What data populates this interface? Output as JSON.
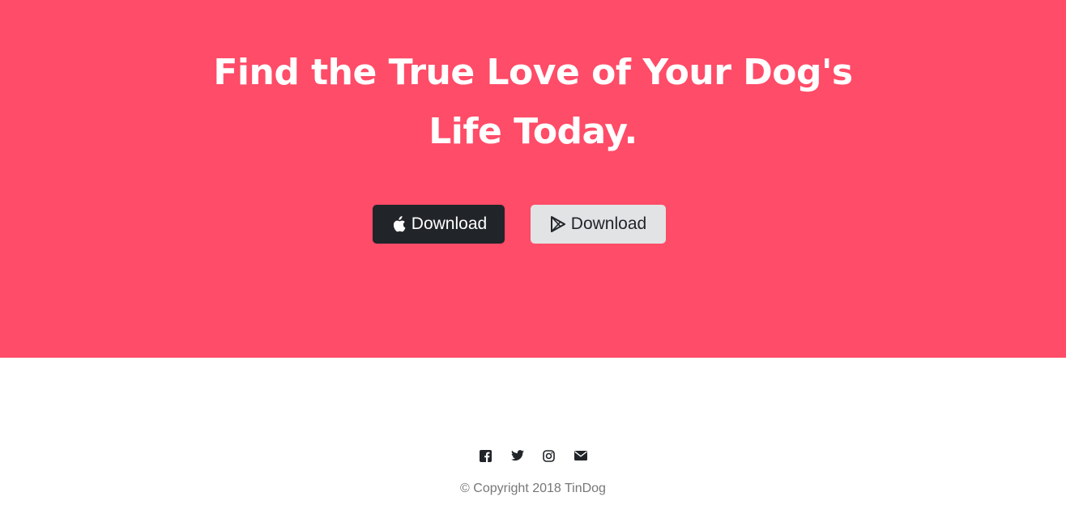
{
  "cta": {
    "background": "#ff4c68",
    "headline_line1": "Find the True Love of Your Dog's",
    "headline_line2": "Life Today.",
    "apple_button_label": "Download",
    "google_button_label": "Download"
  },
  "footer": {
    "social_icons": [
      "facebook-icon",
      "twitter-icon",
      "instagram-icon",
      "envelope-icon"
    ],
    "copyright": "© Copyright 2018 TinDog"
  }
}
